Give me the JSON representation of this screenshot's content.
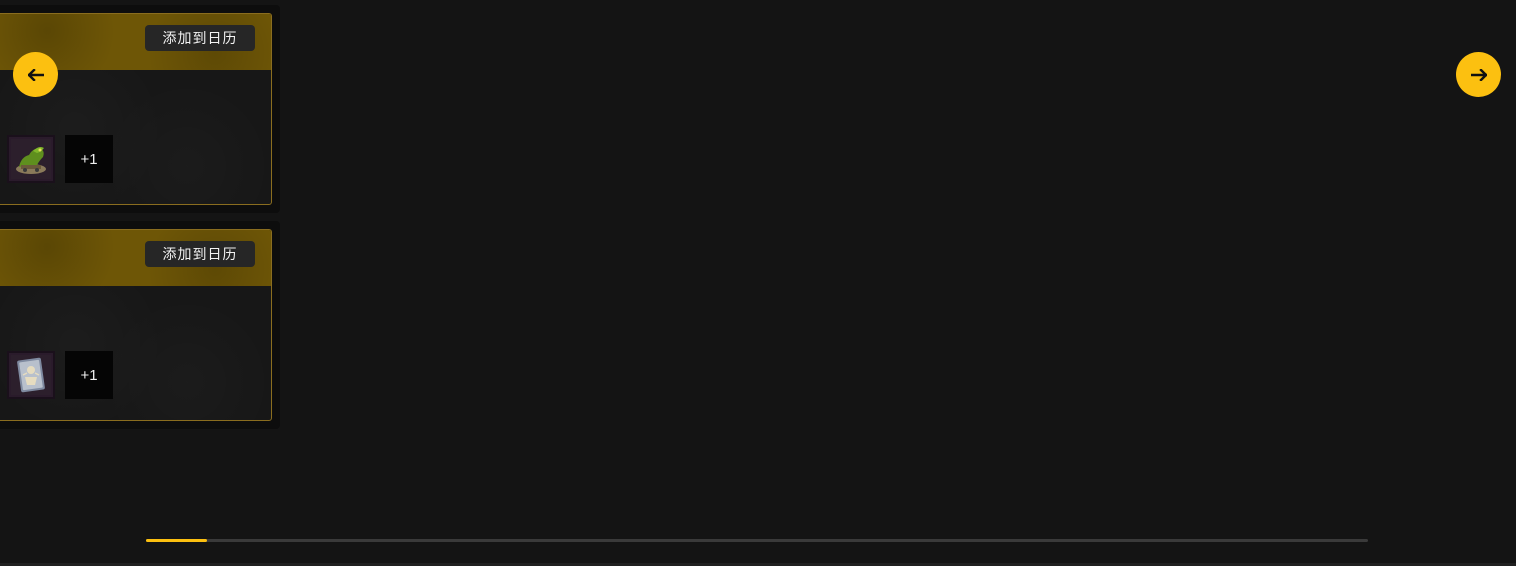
{
  "cards": [
    {
      "calendar_label": "添加到日历",
      "reward_icon": "dragon-tank-icon",
      "more_label": "+1"
    },
    {
      "calendar_label": "添加到日历",
      "reward_icon": "card-skeleton-icon",
      "more_label": "+1"
    }
  ],
  "nav": {
    "prev_icon": "arrow-left-icon",
    "next_icon": "arrow-right-icon"
  },
  "scroll": {
    "position_fraction": 0.05
  },
  "colors": {
    "accent": "#fcc010",
    "header": "#6e5606",
    "card_border": "#8a6d1f",
    "background": "#141414"
  }
}
